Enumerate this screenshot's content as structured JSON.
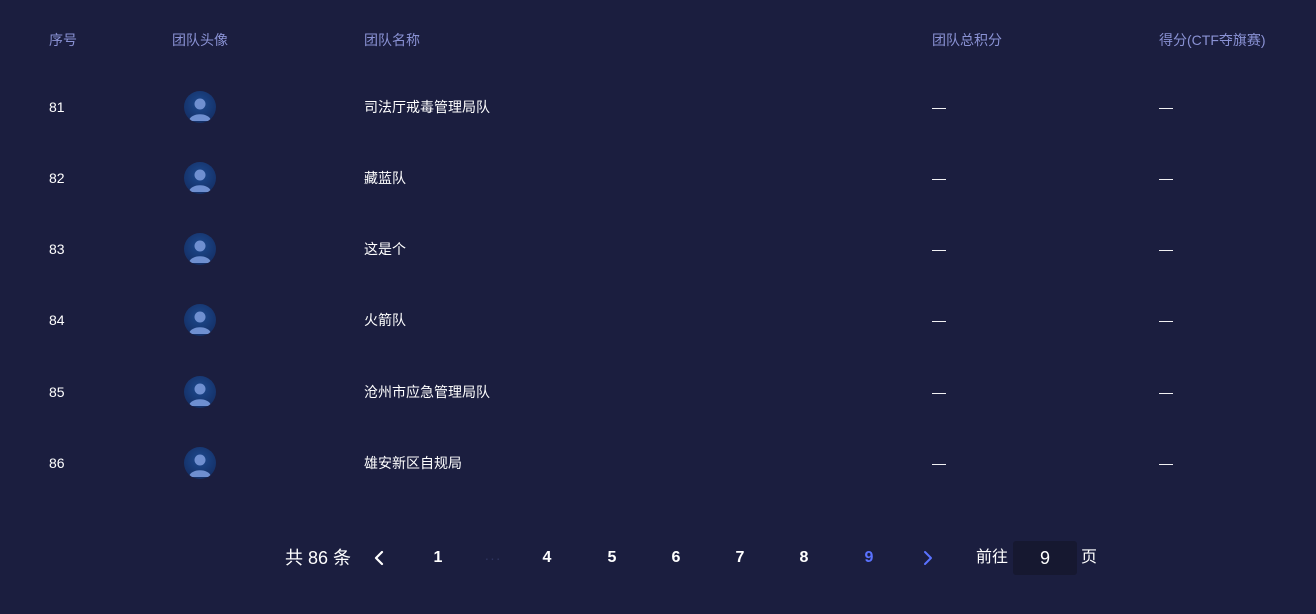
{
  "table": {
    "headers": {
      "index": "序号",
      "avatar": "团队头像",
      "name": "团队名称",
      "total_points": "团队总积分",
      "score": "得分(CTF夺旗赛)"
    },
    "rows": [
      {
        "index": "81",
        "name": "司法厅戒毒管理局队",
        "total_points": "—",
        "score": "—"
      },
      {
        "index": "82",
        "name": "藏蓝队",
        "total_points": "—",
        "score": "—"
      },
      {
        "index": "83",
        "name": "这是个",
        "total_points": "—",
        "score": "—"
      },
      {
        "index": "84",
        "name": "火箭队",
        "total_points": "—",
        "score": "—"
      },
      {
        "index": "85",
        "name": "沧州市应急管理局队",
        "total_points": "—",
        "score": "—"
      },
      {
        "index": "86",
        "name": "雄安新区自规局",
        "total_points": "—",
        "score": "—"
      }
    ],
    "avatar_icon": "user-avatar-icon"
  },
  "pagination": {
    "total_text": "共 86 条",
    "prev_icon": "chevron-left-icon",
    "next_icon": "chevron-right-icon",
    "pages": [
      "1",
      "4",
      "5",
      "6",
      "7",
      "8",
      "9"
    ],
    "ellipsis": "···",
    "current_page": "9",
    "goto_prefix": "前往",
    "goto_value": "9",
    "goto_suffix": "页"
  },
  "colors": {
    "background": "#1b1e3f",
    "header_text": "#8a92d4",
    "body_text": "#ffffff",
    "active_page": "#5a72ff",
    "avatar_bg": "#15326a"
  }
}
